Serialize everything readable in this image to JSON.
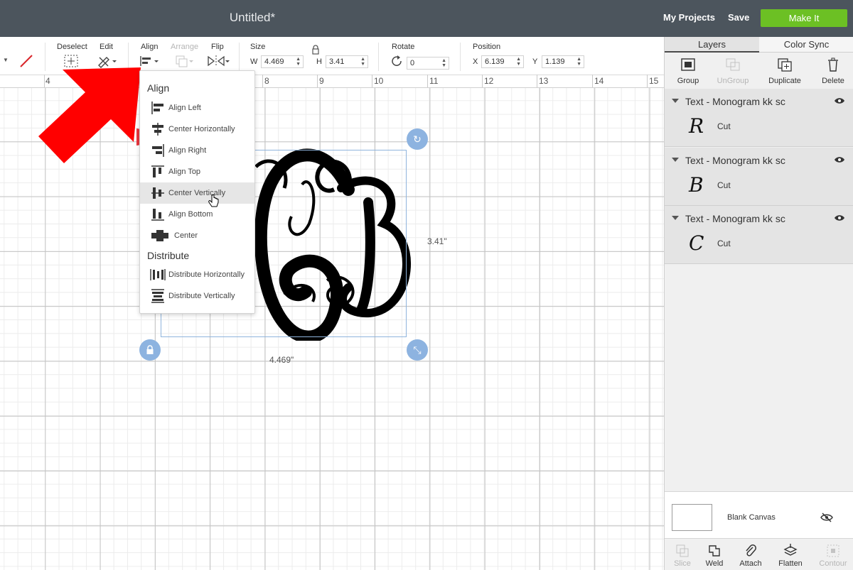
{
  "header": {
    "title": "Untitled*",
    "my_projects": "My Projects",
    "save": "Save",
    "make_it": "Make It"
  },
  "toolbar": {
    "deselect": "Deselect",
    "edit": "Edit",
    "align": "Align",
    "arrange": "Arrange",
    "flip": "Flip",
    "size": "Size",
    "w_label": "W",
    "w_value": "4.469",
    "h_label": "H",
    "h_value": "3.41",
    "rotate": "Rotate",
    "rotate_value": "0",
    "position": "Position",
    "x_label": "X",
    "x_value": "6.139",
    "y_label": "Y",
    "y_value": "1.139"
  },
  "ruler": {
    "numbers": [
      "4",
      "8",
      "9",
      "10",
      "11",
      "12",
      "13",
      "14",
      "15"
    ]
  },
  "canvas": {
    "width_label": "4.469\"",
    "height_label": "3.41\"",
    "monogram": "CBR"
  },
  "align_menu": {
    "align_heading": "Align",
    "items": [
      "Align Left",
      "Center Horizontally",
      "Align Right",
      "Align Top",
      "Center Vertically",
      "Align Bottom",
      "Center"
    ],
    "distribute_heading": "Distribute",
    "distribute_items": [
      "Distribute Horizontally",
      "Distribute Vertically"
    ],
    "hovered": "Center Vertically"
  },
  "panel": {
    "tabs": [
      "Layers",
      "Color Sync"
    ],
    "actions": [
      "Group",
      "UnGroup",
      "Duplicate",
      "Delete"
    ],
    "layers": [
      {
        "title": "Text - Monogram kk sc",
        "glyph": "R",
        "operation": "Cut"
      },
      {
        "title": "Text - Monogram kk sc",
        "glyph": "B",
        "operation": "Cut"
      },
      {
        "title": "Text - Monogram kk sc",
        "glyph": "C",
        "operation": "Cut"
      }
    ],
    "blank_canvas": "Blank Canvas",
    "bottom_tools": [
      "Slice",
      "Weld",
      "Attach",
      "Flatten",
      "Contour"
    ]
  },
  "colors": {
    "header_bg": "#4c555d",
    "make_it": "#6cc024",
    "selection": "#8fb4dd",
    "arrow": "#ff0000"
  }
}
